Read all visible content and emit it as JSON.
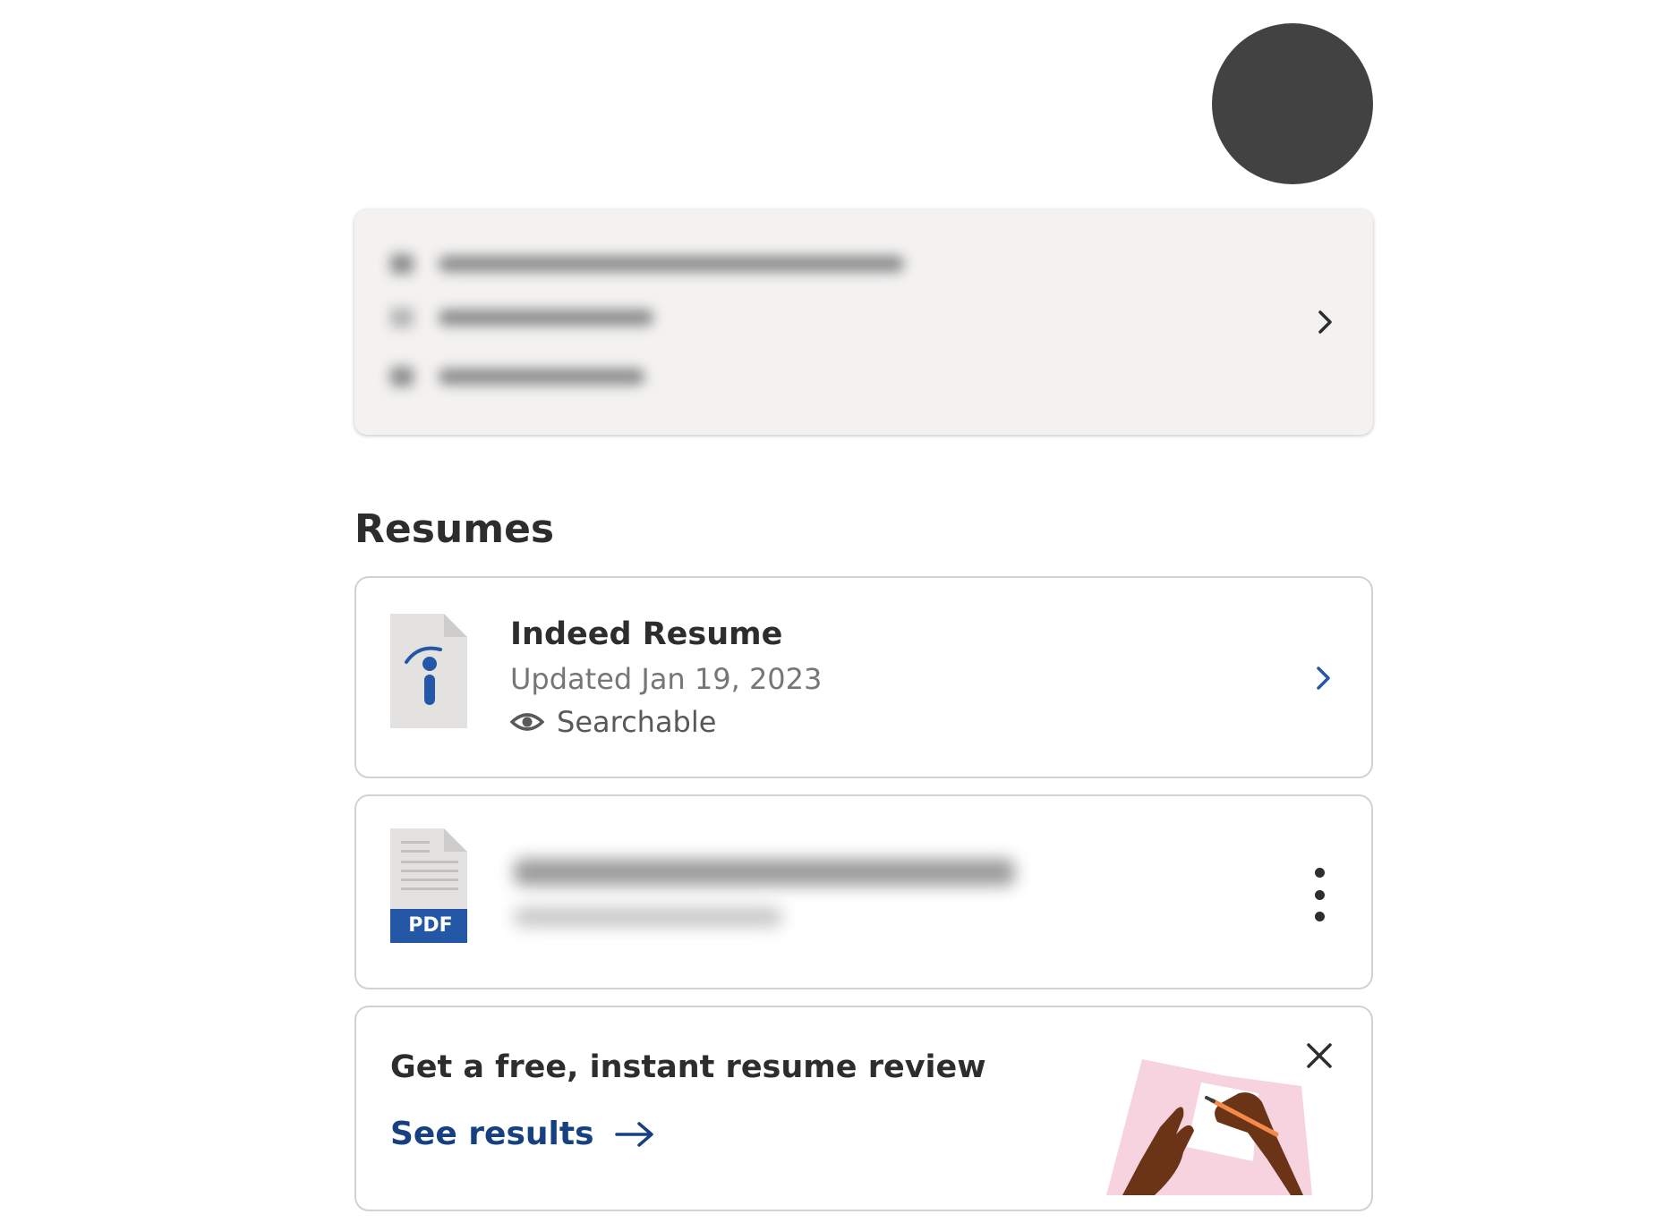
{
  "profile": {
    "avatar_color": "#424242"
  },
  "contact_card": {
    "background": "#f3f2f1",
    "chevron_icon": "chevron-right-icon"
  },
  "resumes": {
    "heading": "Resumes",
    "items": [
      {
        "title": "Indeed Resume",
        "updated": "Updated Jan 19, 2023",
        "status": "Searchable",
        "status_icon": "eye-icon",
        "file_icon": "indeed-doc-icon",
        "action_icon": "chevron-right-icon"
      },
      {
        "file_badge": "PDF",
        "file_icon": "pdf-doc-icon",
        "action_icon": "more-vertical-icon"
      }
    ]
  },
  "review_promo": {
    "title": "Get a free, instant resume review",
    "link_label": "See results",
    "link_icon": "arrow-right-icon",
    "close_icon": "close-icon"
  },
  "colors": {
    "accent_blue": "#164081",
    "indeed_blue": "#2557a7",
    "text_primary": "#2d2d2d",
    "text_secondary": "#767676",
    "border": "#d4d2d0"
  }
}
